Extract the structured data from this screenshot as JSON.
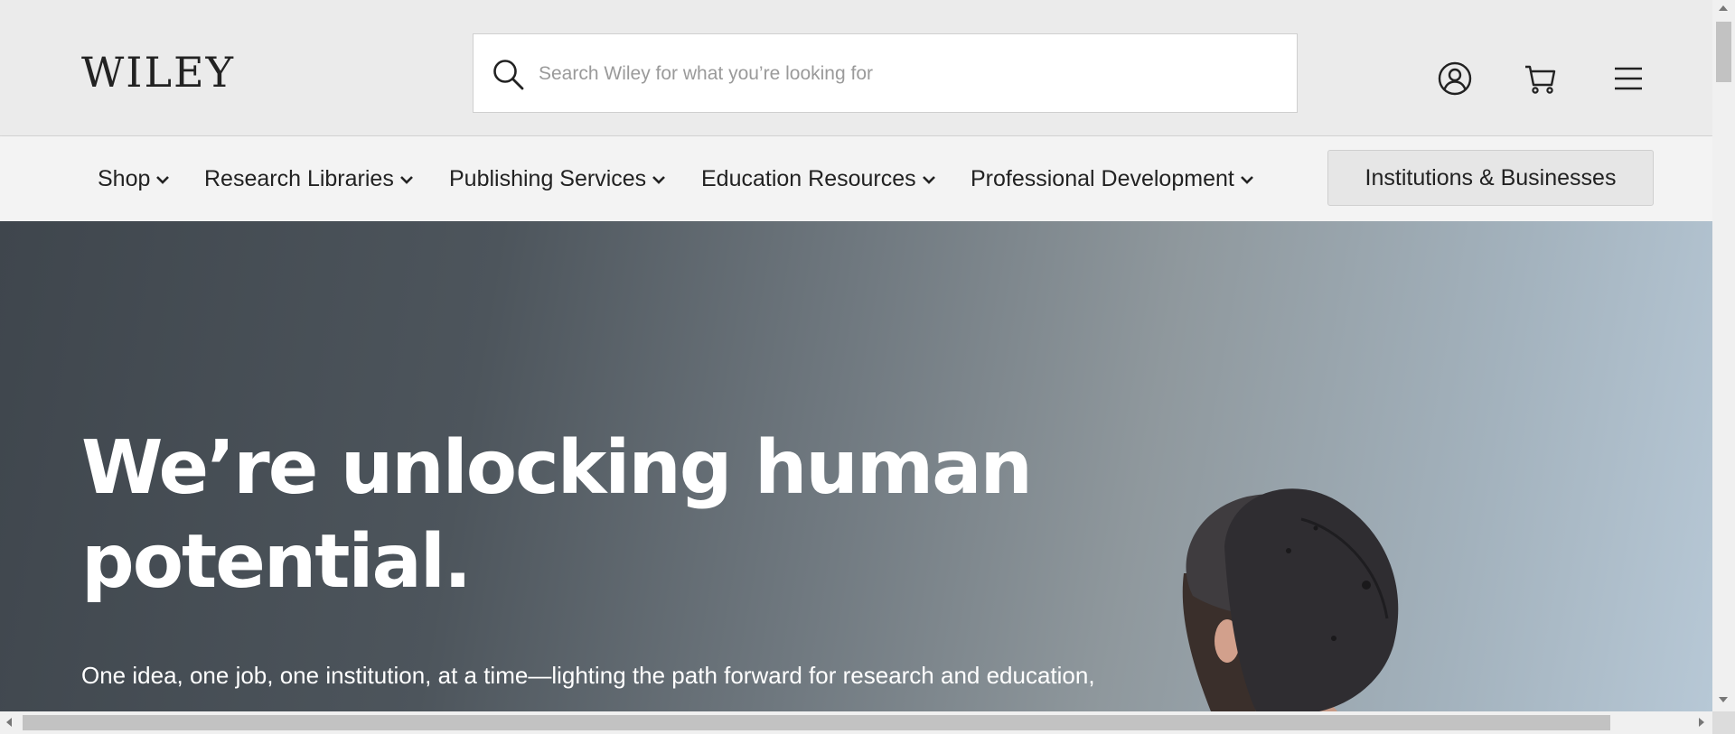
{
  "header": {
    "logo_text": "WILEY",
    "search_placeholder": "Search Wiley for what you’re looking for",
    "icons": [
      "search-icon",
      "account-icon",
      "cart-icon",
      "hamburger-menu-icon"
    ]
  },
  "nav": {
    "items": [
      {
        "label": "Shop"
      },
      {
        "label": "Research Libraries"
      },
      {
        "label": "Publishing Services"
      },
      {
        "label": "Education Resources"
      },
      {
        "label": "Professional Development"
      }
    ],
    "cta_label": "Institutions & Businesses"
  },
  "hero": {
    "title": "We’re unlocking human potential.",
    "subtitle": "One idea, one job, one institution, at a time—lighting the path forward for research and education,"
  },
  "colors": {
    "header_bg": "#ebebeb",
    "nav_bg": "#f3f3f3",
    "text_dark": "#222222",
    "hero_text": "#ffffff"
  }
}
